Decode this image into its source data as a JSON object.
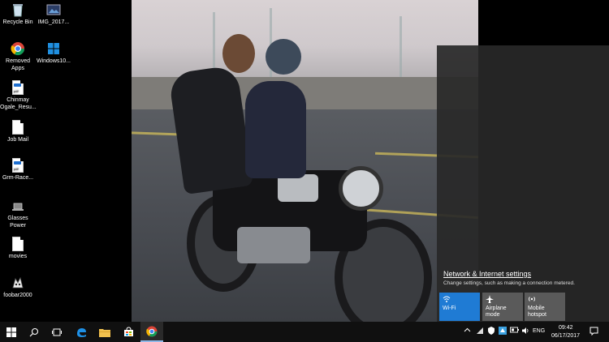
{
  "desktop": {
    "icons": [
      {
        "label": "Recycle Bin",
        "icon": "recycle-bin-icon"
      },
      {
        "label": "IMG_2017...",
        "icon": "image-file-icon"
      },
      {
        "label": "Removed Apps",
        "icon": "chrome-icon"
      },
      {
        "label": "Windows10...",
        "icon": "windows-logo-icon"
      },
      {
        "label": "Chinmay Ogale_Resu...",
        "icon": "pdf-file-icon",
        "badge": "pdf"
      },
      {
        "label": "Job Mail",
        "icon": "document-icon"
      },
      {
        "label": "Grm-Race...",
        "icon": "pdf-file-icon",
        "badge": "pdf"
      },
      {
        "label": "Glasses Power",
        "icon": "laptop-icon"
      },
      {
        "label": "movies",
        "icon": "document-icon"
      },
      {
        "label": "foobar2000",
        "icon": "foobar-icon"
      }
    ]
  },
  "action_center": {
    "network_link": "Network & Internet settings",
    "network_desc": "Change settings, such as making a connection metered.",
    "tiles": [
      {
        "label": "Wi-Fi",
        "icon": "wifi-icon",
        "active": true
      },
      {
        "label": "Airplane mode",
        "icon": "airplane-icon",
        "active": false
      },
      {
        "label": "Mobile hotspot",
        "icon": "hotspot-icon",
        "active": false
      }
    ]
  },
  "taskbar": {
    "language": "ENG",
    "time": "09:42",
    "date": "06/17/2017"
  },
  "colors": {
    "accent": "#1f7bd4",
    "taskbar": "#101010",
    "panel": "#282828"
  }
}
